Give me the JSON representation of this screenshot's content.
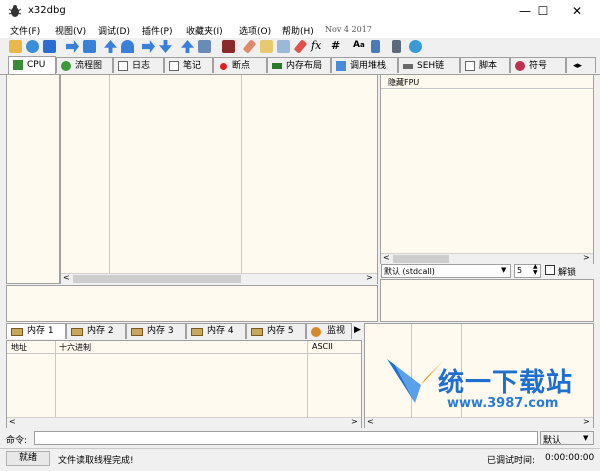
{
  "window": {
    "title": "x32dbg"
  },
  "menu": {
    "items": [
      "文件(F)",
      "视图(V)",
      "调试(D)",
      "插件(P)",
      "收藏夹(I)",
      "选项(O)",
      "帮助(H)"
    ],
    "date": "Nov 4 2017"
  },
  "tabs": [
    "CPU",
    "流程图",
    "日志",
    "笔记",
    "断点",
    "内存布局",
    "调用堆栈",
    "SEH链",
    "脚本",
    "符号"
  ],
  "fpu_header": "隐藏FPU",
  "callconv": {
    "value": "默认 (stdcall)",
    "count": "5",
    "unlock_label": "解锁"
  },
  "dump": {
    "tabs": [
      "内存 1",
      "内存 2",
      "内存 3",
      "内存 4",
      "内存 5",
      "监视"
    ],
    "columns": [
      "地址",
      "十六进制",
      "ASCII"
    ]
  },
  "command": {
    "label": "命令:",
    "value": "",
    "mode": "默认"
  },
  "status": {
    "state": "就绪",
    "message": "文件读取线程完成!",
    "time_label": "已调试时间:",
    "time_value": "0:00:00:00"
  },
  "watermark": {
    "title": "统一下载站",
    "url": "www.3987.com"
  },
  "colors": {
    "pane_bg": "#fffaf0",
    "accent": "#0078d7",
    "watermark_blue": "#1e6fd0",
    "watermark_orange": "#f08a00"
  }
}
